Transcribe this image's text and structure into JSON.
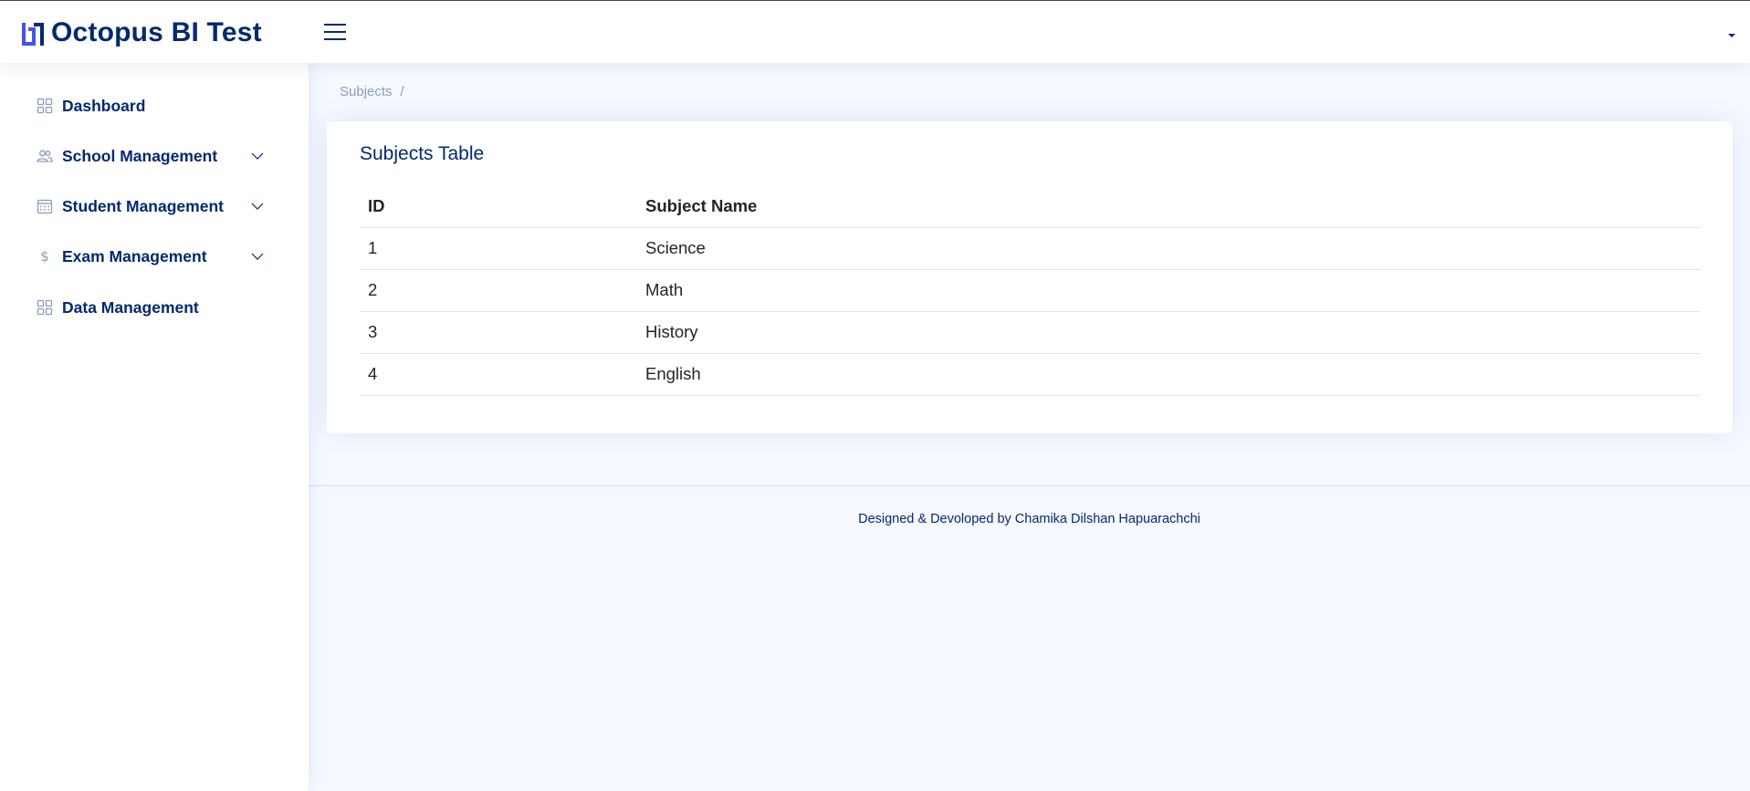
{
  "app": {
    "title": "Octopus BI Test"
  },
  "header": {
    "menu_icon": "hamburger-menu-icon",
    "profile_icon": "caret-down-icon"
  },
  "sidebar": {
    "items": [
      {
        "label": "Dashboard",
        "icon": "grid-icon",
        "has_submenu": false
      },
      {
        "label": "School Management",
        "icon": "people-icon",
        "has_submenu": true
      },
      {
        "label": "Student Management",
        "icon": "calendar-icon",
        "has_submenu": true
      },
      {
        "label": "Exam Management",
        "icon": "dollar-icon",
        "has_submenu": true
      },
      {
        "label": "Data Management",
        "icon": "grid-icon",
        "has_submenu": false
      }
    ]
  },
  "breadcrumb": {
    "current": "Subjects",
    "separator": "/"
  },
  "card": {
    "title": "Subjects Table",
    "columns": [
      "ID",
      "Subject Name"
    ],
    "rows": [
      [
        "1",
        "Science"
      ],
      [
        "2",
        "Math"
      ],
      [
        "3",
        "History"
      ],
      [
        "4",
        "English"
      ]
    ]
  },
  "footer": {
    "text": "Designed & Devoloped by Chamika Dilshan Hapuarachchi"
  },
  "colors": {
    "primary": "#012970",
    "accent": "#4154f1",
    "muted": "#899bbd",
    "background": "#f6f9ff"
  }
}
